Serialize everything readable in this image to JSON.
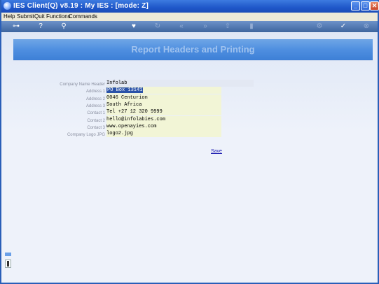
{
  "window": {
    "title": "IES Client(Q) v8.19 : My IES :     [mode: Z]",
    "controls": {
      "minimize": "_",
      "maximize": "□",
      "close": "✕"
    }
  },
  "menu": {
    "items": [
      "Help",
      "Submit",
      "Quit",
      "Functions",
      "Commands"
    ]
  },
  "toolbar": {
    "icons": [
      "key-icon",
      "help-icon",
      "search-icon",
      "heart-icon",
      "refresh-icon",
      "back-icon",
      "forward-icon",
      "up-icon",
      "pin-icon",
      "settings-icon",
      "check-icon",
      "cancel-icon"
    ],
    "glyphs": {
      "key": "⊶",
      "help": "?",
      "search": "⚲",
      "heart": "♥",
      "refresh": "↻",
      "back": "«",
      "forward": "»",
      "up": "⇧",
      "pin": "▮",
      "settings": "⚙",
      "check": "✓",
      "cancel": "⊗"
    }
  },
  "banner": {
    "title": "Report Headers and Printing"
  },
  "form": {
    "fields": [
      {
        "label": "Company Name Header",
        "value": "Infolab"
      },
      {
        "label": "Address 1",
        "value": "PO Box 13141"
      },
      {
        "label": "Address 2",
        "value": "0046 Centurion"
      },
      {
        "label": "Address 3",
        "value": "South Africa"
      },
      {
        "label": "Contact 1",
        "value": "Tel +27 12 320 9999"
      },
      {
        "label": "Contact 2",
        "value": "hello@infolabies.com"
      },
      {
        "label": "Contact 3",
        "value": "www.openayies.com"
      },
      {
        "label": "Company Logo JPG",
        "value": "logo2.jpg"
      }
    ],
    "save_label": "Save"
  },
  "colors": {
    "titlebar": "#1f57c9",
    "toolbar": "#4f76b1",
    "banner": "#4f8fe0",
    "selection": "#2a52a8",
    "link": "#1b1bb0"
  }
}
